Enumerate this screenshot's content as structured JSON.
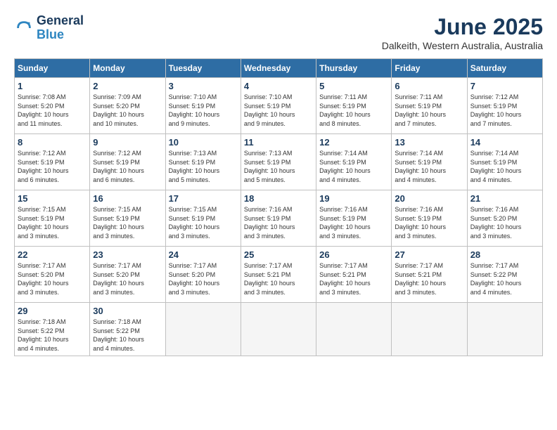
{
  "logo": {
    "line1": "General",
    "line2": "Blue"
  },
  "title": {
    "month_year": "June 2025",
    "location": "Dalkeith, Western Australia, Australia"
  },
  "calendar": {
    "headers": [
      "Sunday",
      "Monday",
      "Tuesday",
      "Wednesday",
      "Thursday",
      "Friday",
      "Saturday"
    ],
    "weeks": [
      [
        {
          "day": "",
          "info": ""
        },
        {
          "day": "2",
          "info": "Sunrise: 7:09 AM\nSunset: 5:20 PM\nDaylight: 10 hours\nand 10 minutes."
        },
        {
          "day": "3",
          "info": "Sunrise: 7:10 AM\nSunset: 5:19 PM\nDaylight: 10 hours\nand 9 minutes."
        },
        {
          "day": "4",
          "info": "Sunrise: 7:10 AM\nSunset: 5:19 PM\nDaylight: 10 hours\nand 9 minutes."
        },
        {
          "day": "5",
          "info": "Sunrise: 7:11 AM\nSunset: 5:19 PM\nDaylight: 10 hours\nand 8 minutes."
        },
        {
          "day": "6",
          "info": "Sunrise: 7:11 AM\nSunset: 5:19 PM\nDaylight: 10 hours\nand 7 minutes."
        },
        {
          "day": "7",
          "info": "Sunrise: 7:12 AM\nSunset: 5:19 PM\nDaylight: 10 hours\nand 7 minutes."
        }
      ],
      [
        {
          "day": "1",
          "info": "Sunrise: 7:08 AM\nSunset: 5:20 PM\nDaylight: 10 hours\nand 11 minutes."
        },
        null,
        null,
        null,
        null,
        null,
        null
      ],
      [
        {
          "day": "8",
          "info": "Sunrise: 7:12 AM\nSunset: 5:19 PM\nDaylight: 10 hours\nand 6 minutes."
        },
        {
          "day": "9",
          "info": "Sunrise: 7:12 AM\nSunset: 5:19 PM\nDaylight: 10 hours\nand 6 minutes."
        },
        {
          "day": "10",
          "info": "Sunrise: 7:13 AM\nSunset: 5:19 PM\nDaylight: 10 hours\nand 5 minutes."
        },
        {
          "day": "11",
          "info": "Sunrise: 7:13 AM\nSunset: 5:19 PM\nDaylight: 10 hours\nand 5 minutes."
        },
        {
          "day": "12",
          "info": "Sunrise: 7:14 AM\nSunset: 5:19 PM\nDaylight: 10 hours\nand 4 minutes."
        },
        {
          "day": "13",
          "info": "Sunrise: 7:14 AM\nSunset: 5:19 PM\nDaylight: 10 hours\nand 4 minutes."
        },
        {
          "day": "14",
          "info": "Sunrise: 7:14 AM\nSunset: 5:19 PM\nDaylight: 10 hours\nand 4 minutes."
        }
      ],
      [
        {
          "day": "15",
          "info": "Sunrise: 7:15 AM\nSunset: 5:19 PM\nDaylight: 10 hours\nand 3 minutes."
        },
        {
          "day": "16",
          "info": "Sunrise: 7:15 AM\nSunset: 5:19 PM\nDaylight: 10 hours\nand 3 minutes."
        },
        {
          "day": "17",
          "info": "Sunrise: 7:15 AM\nSunset: 5:19 PM\nDaylight: 10 hours\nand 3 minutes."
        },
        {
          "day": "18",
          "info": "Sunrise: 7:16 AM\nSunset: 5:19 PM\nDaylight: 10 hours\nand 3 minutes."
        },
        {
          "day": "19",
          "info": "Sunrise: 7:16 AM\nSunset: 5:19 PM\nDaylight: 10 hours\nand 3 minutes."
        },
        {
          "day": "20",
          "info": "Sunrise: 7:16 AM\nSunset: 5:19 PM\nDaylight: 10 hours\nand 3 minutes."
        },
        {
          "day": "21",
          "info": "Sunrise: 7:16 AM\nSunset: 5:20 PM\nDaylight: 10 hours\nand 3 minutes."
        }
      ],
      [
        {
          "day": "22",
          "info": "Sunrise: 7:17 AM\nSunset: 5:20 PM\nDaylight: 10 hours\nand 3 minutes."
        },
        {
          "day": "23",
          "info": "Sunrise: 7:17 AM\nSunset: 5:20 PM\nDaylight: 10 hours\nand 3 minutes."
        },
        {
          "day": "24",
          "info": "Sunrise: 7:17 AM\nSunset: 5:20 PM\nDaylight: 10 hours\nand 3 minutes."
        },
        {
          "day": "25",
          "info": "Sunrise: 7:17 AM\nSunset: 5:21 PM\nDaylight: 10 hours\nand 3 minutes."
        },
        {
          "day": "26",
          "info": "Sunrise: 7:17 AM\nSunset: 5:21 PM\nDaylight: 10 hours\nand 3 minutes."
        },
        {
          "day": "27",
          "info": "Sunrise: 7:17 AM\nSunset: 5:21 PM\nDaylight: 10 hours\nand 3 minutes."
        },
        {
          "day": "28",
          "info": "Sunrise: 7:17 AM\nSunset: 5:22 PM\nDaylight: 10 hours\nand 4 minutes."
        }
      ],
      [
        {
          "day": "29",
          "info": "Sunrise: 7:18 AM\nSunset: 5:22 PM\nDaylight: 10 hours\nand 4 minutes."
        },
        {
          "day": "30",
          "info": "Sunrise: 7:18 AM\nSunset: 5:22 PM\nDaylight: 10 hours\nand 4 minutes."
        },
        {
          "day": "",
          "info": ""
        },
        {
          "day": "",
          "info": ""
        },
        {
          "day": "",
          "info": ""
        },
        {
          "day": "",
          "info": ""
        },
        {
          "day": "",
          "info": ""
        }
      ]
    ]
  }
}
